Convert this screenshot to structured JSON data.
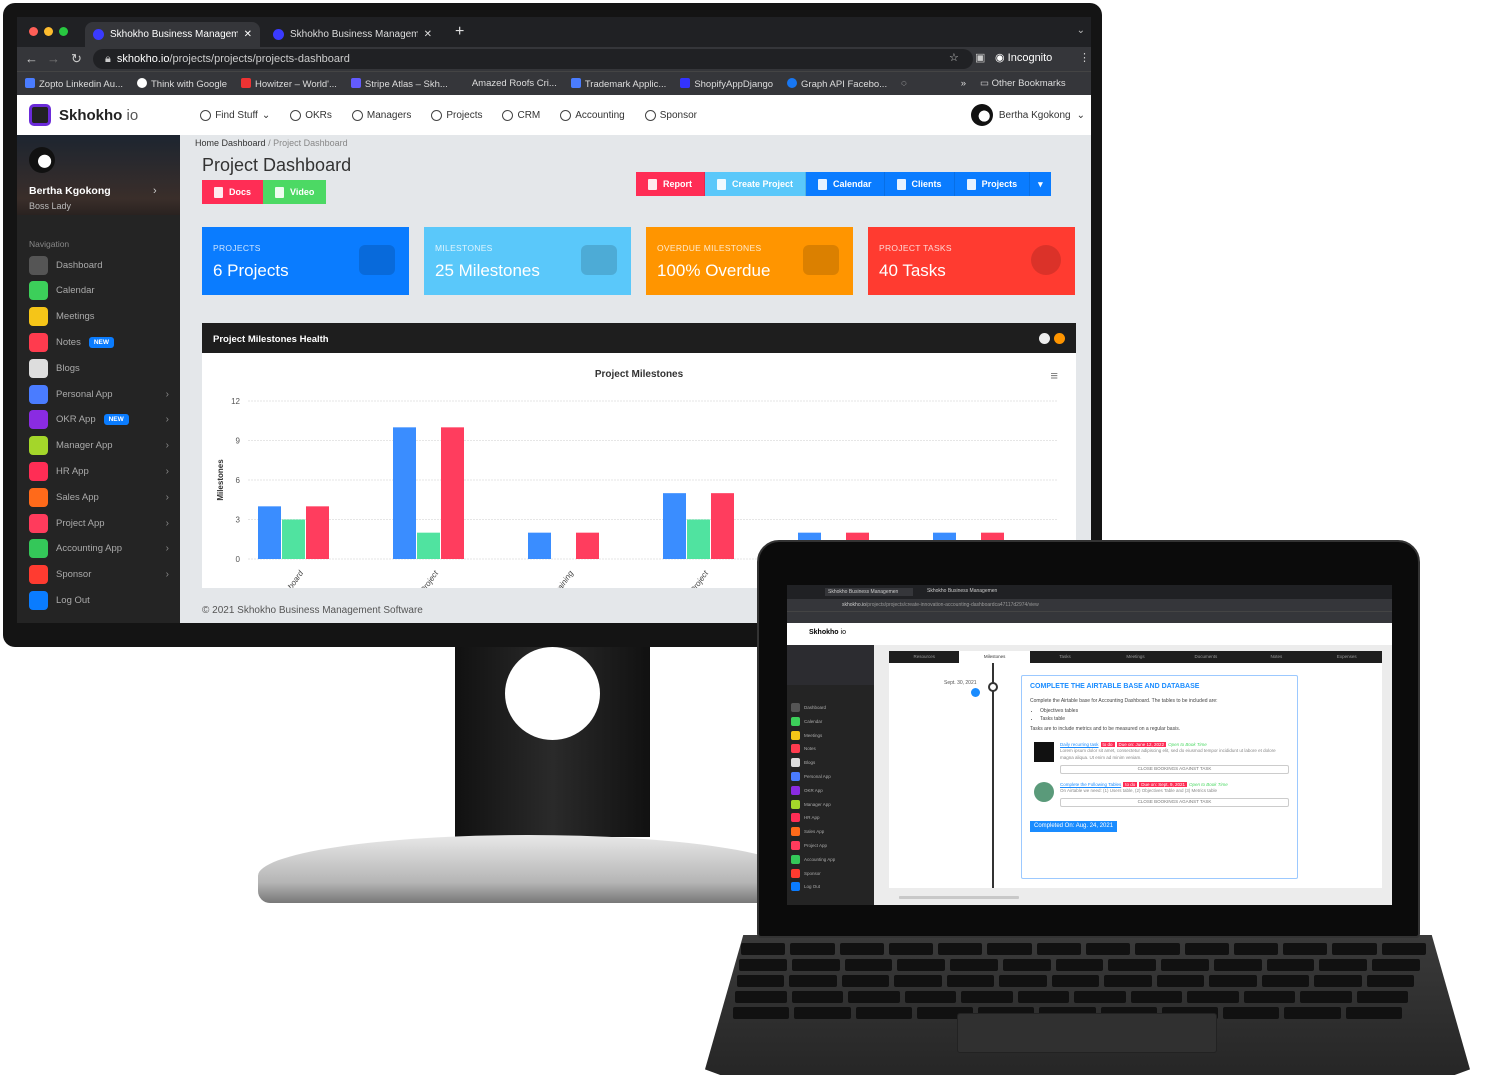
{
  "browser": {
    "tabs": [
      {
        "title": "Skhokho Business Managemen"
      },
      {
        "title": "Skhokho Business Managemen"
      }
    ],
    "url_host": "skhokho.io",
    "url_path": "/projects/projects/projects-dashboard",
    "profile": "Incognito",
    "bookmarks": [
      "Zopto Linkedin Au...",
      "Think with Google",
      "Howitzer – World'...",
      "Stripe Atlas – Skh...",
      "Amazed Roofs Cri...",
      "Trademark Applic...",
      "ShopifyAppDjango",
      "Graph API Facebo..."
    ],
    "other_bookmarks": "Other Bookmarks"
  },
  "app": {
    "brand": "Skhokho",
    "brand_suffix": "io",
    "nav": [
      "Find Stuff",
      "OKRs",
      "Managers",
      "Projects",
      "CRM",
      "Accounting",
      "Sponsor"
    ],
    "user": "Bertha Kgokong"
  },
  "sidebar": {
    "name": "Bertha Kgokong",
    "role": "Boss Lady",
    "section": "Navigation",
    "items": [
      {
        "label": "Dashboard",
        "color": "#555555"
      },
      {
        "label": "Calendar",
        "color": "#3ccf5a"
      },
      {
        "label": "Meetings",
        "color": "#f5c518"
      },
      {
        "label": "Notes",
        "color": "#ff3b4e",
        "badge": "NEW"
      },
      {
        "label": "Blogs",
        "color": "#dddddd"
      },
      {
        "label": "Personal App",
        "color": "#4a7cff",
        "chevron": true
      },
      {
        "label": "OKR App",
        "color": "#8a2be2",
        "badge": "NEW",
        "chevron": true
      },
      {
        "label": "Manager App",
        "color": "#a4d62a",
        "chevron": true
      },
      {
        "label": "HR App",
        "color": "#ff2d55",
        "chevron": true
      },
      {
        "label": "Sales App",
        "color": "#ff6a1a",
        "chevron": true
      },
      {
        "label": "Project App",
        "color": "#ff3b5c",
        "chevron": true
      },
      {
        "label": "Accounting App",
        "color": "#34c759",
        "chevron": true
      },
      {
        "label": "Sponsor",
        "color": "#ff3b30",
        "chevron": true
      },
      {
        "label": "Log Out",
        "color": "#0a7cff"
      }
    ]
  },
  "main": {
    "breadcrumb": [
      "Home Dashboard",
      "Project Dashboard"
    ],
    "title": "Project Dashboard",
    "doc_buttons": [
      {
        "label": "Docs",
        "color": "#ff2d55"
      },
      {
        "label": "Video",
        "color": "#4cd964"
      }
    ],
    "actions": [
      {
        "label": "Report",
        "color": "#ff2d55"
      },
      {
        "label": "Create Project",
        "color": "#5ac8fa"
      },
      {
        "label": "Calendar",
        "color": "#0a7cff"
      },
      {
        "label": "Clients",
        "color": "#0a7cff"
      },
      {
        "label": "Projects",
        "color": "#0a7cff"
      }
    ],
    "cards": [
      {
        "label": "PROJECTS",
        "value": "6 Projects",
        "color": "#0a7cff",
        "icon": "users-icon"
      },
      {
        "label": "MILESTONES",
        "value": "25 Milestones",
        "color": "#5ac8fa",
        "icon": "link-icon"
      },
      {
        "label": "OVERDUE MILESTONES",
        "value": "100% Overdue",
        "color": "#ff9500",
        "icon": "monitor-icon"
      },
      {
        "label": "PROJECT TASKS",
        "value": "40 Tasks",
        "color": "#ff3b30",
        "icon": "clock-icon"
      }
    ],
    "panel_title": "Project Milestones Health",
    "footer": "© 2021 Skhokho Business Management Software"
  },
  "chart_data": {
    "type": "bar",
    "title": "Project Milestones",
    "xlabel": "",
    "ylabel": "Milestones",
    "ylim": [
      0,
      12
    ],
    "yticks": [
      0,
      3,
      6,
      9,
      12
    ],
    "grid": true,
    "categories": [
      "shboard",
      "d Project",
      "Training",
      "d Project",
      "",
      ""
    ],
    "series": [
      {
        "color": "#3a8dff",
        "values": [
          4,
          10,
          2,
          5,
          2,
          2
        ]
      },
      {
        "color": "#50e3a0",
        "values": [
          3,
          2,
          0,
          3,
          null,
          null
        ]
      },
      {
        "color": "#ff3d5e",
        "values": [
          4,
          10,
          2,
          5,
          2,
          2
        ]
      }
    ]
  },
  "laptop": {
    "url_path": "/projects/projects/create-innovation-accounting-dashboardca47117d2974/view",
    "tabs": [
      "Resources",
      "Milestones",
      "Tasks",
      "Meetings",
      "Documents",
      "Notes",
      "Expenses"
    ],
    "date": "Sept. 30, 2021",
    "milestone_title": "COMPLETE THE AIRTABLE BASE AND DATABASE",
    "desc": "Complete the Airtable base for Accounting Dashboard. The tables to be included are:",
    "bullets": [
      "Objectives tables",
      "Tasks table"
    ],
    "desc2": "Tasks are to include metrics and to be measured on a regular basis.",
    "tasks": [
      {
        "title": "Daily recurring task",
        "status": "to do",
        "due": "Due on: June 12, 2022",
        "open": "Open to Book Time",
        "text": "Lorem ipsum dolor sit amet, consectetur adipiscing elit, sed do eiusmod tempor incididunt ut labore et dolore magna aliqua. Ut enim ad minim veniam.",
        "close": "CLOSE BOOKINGS AGAINST TASK"
      },
      {
        "title": "Complete the Following Tables",
        "status": "to do",
        "due": "Due on: Sept. 9, 2021",
        "open": "Open to Book Time",
        "text": "On Airtable we need: (1) Users table, (2) Objectives Table and (3) Metrics table",
        "close": "CLOSE BOOKINGS AGAINST TASK"
      }
    ],
    "completed": "Completed On: Aug. 24, 2021"
  }
}
